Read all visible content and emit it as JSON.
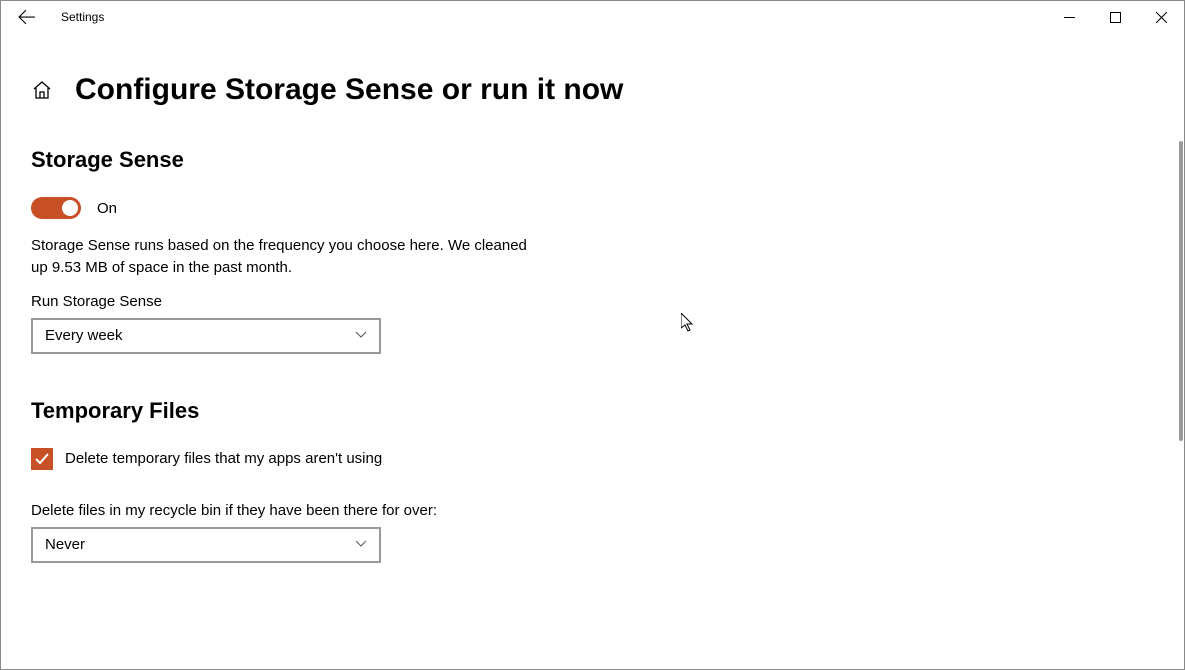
{
  "titlebar": {
    "title": "Settings"
  },
  "page": {
    "title": "Configure Storage Sense or run it now"
  },
  "storageSense": {
    "heading": "Storage Sense",
    "toggleLabel": "On",
    "description": "Storage Sense runs based on the frequency you choose here. We cleaned up 9.53 MB of space in the past month.",
    "runLabel": "Run Storage Sense",
    "runValue": "Every week"
  },
  "tempFiles": {
    "heading": "Temporary Files",
    "deleteTempLabel": "Delete temporary files that my apps aren't using",
    "recycleLabel": "Delete files in my recycle bin if they have been there for over:",
    "recycleValue": "Never"
  }
}
